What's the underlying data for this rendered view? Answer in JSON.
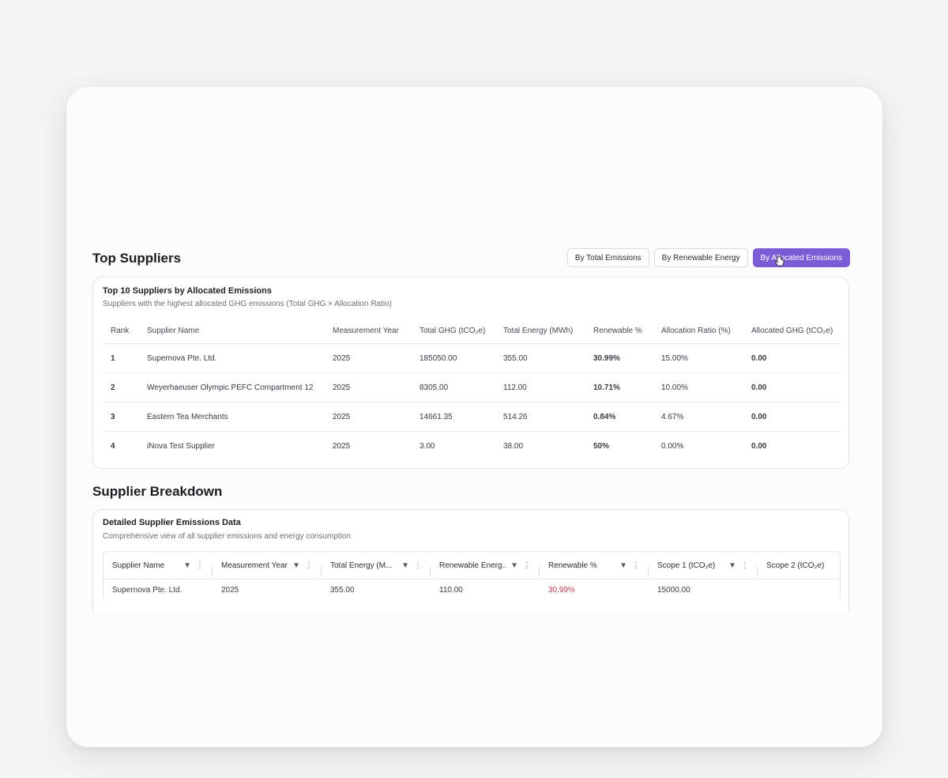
{
  "top_section": {
    "title": "Top Suppliers",
    "tabs": [
      {
        "label": "By Total Emissions",
        "active": false
      },
      {
        "label": "By Renewable Energy",
        "active": false
      },
      {
        "label": "By Allocated Emissions",
        "active": true
      }
    ]
  },
  "top_card": {
    "title": "Top 10 Suppliers by Allocated Emissions",
    "subtitle": "Suppliers with the highest allocated GHG emissions (Total GHG × Allocation Ratio)",
    "columns": [
      "Rank",
      "Supplier Name",
      "Measurement Year",
      "Total GHG (tCO₂e)",
      "Total Energy (MWh)",
      "Renewable %",
      "Allocation Ratio (%)",
      "Allocated GHG (tCO₂e)"
    ],
    "rows": [
      {
        "rank": "1",
        "name": "Supernova Pte. Ltd.",
        "year": "2025",
        "ghg": "185050.00",
        "energy": "355.00",
        "renewable": "30.99%",
        "ratio": "15.00%",
        "allocated": "0.00"
      },
      {
        "rank": "2",
        "name": "Weyerhaeuser Olympic PEFC Compartment 12",
        "year": "2025",
        "ghg": "8305.00",
        "energy": "112.00",
        "renewable": "10.71%",
        "ratio": "10.00%",
        "allocated": "0.00"
      },
      {
        "rank": "3",
        "name": "Eastern Tea Merchants",
        "year": "2025",
        "ghg": "14661.35",
        "energy": "514.26",
        "renewable": "0.84%",
        "ratio": "4.67%",
        "allocated": "0.00"
      },
      {
        "rank": "4",
        "name": "iNova Test Supplier",
        "year": "2025",
        "ghg": "3.00",
        "energy": "38.00",
        "renewable": "50%",
        "ratio": "0.00%",
        "allocated": "0.00"
      }
    ]
  },
  "breakdown_section": {
    "title": "Supplier Breakdown"
  },
  "breakdown_card": {
    "title": "Detailed Supplier Emissions Data",
    "subtitle": "Comprehensive view of all supplier emissions and energy consumption",
    "columns": [
      "Supplier Name",
      "Measurement Year",
      "Total Energy (M...",
      "Renewable Energ...",
      "Renewable %",
      "Scope 1 (tCO₂e)",
      "Scope 2 (tCO₂e)"
    ],
    "rows": [
      {
        "name": "Supernova Pte. Ltd.",
        "year": "2025",
        "energy": "355.00",
        "renewable_energy": "110.00",
        "renewable_pct": "30.99%",
        "scope1": "15000.00",
        "scope2": ""
      }
    ]
  },
  "colors": {
    "accent": "#7b5cd6",
    "renewable": "#c2394f",
    "allocated": "#3b5bd6"
  }
}
